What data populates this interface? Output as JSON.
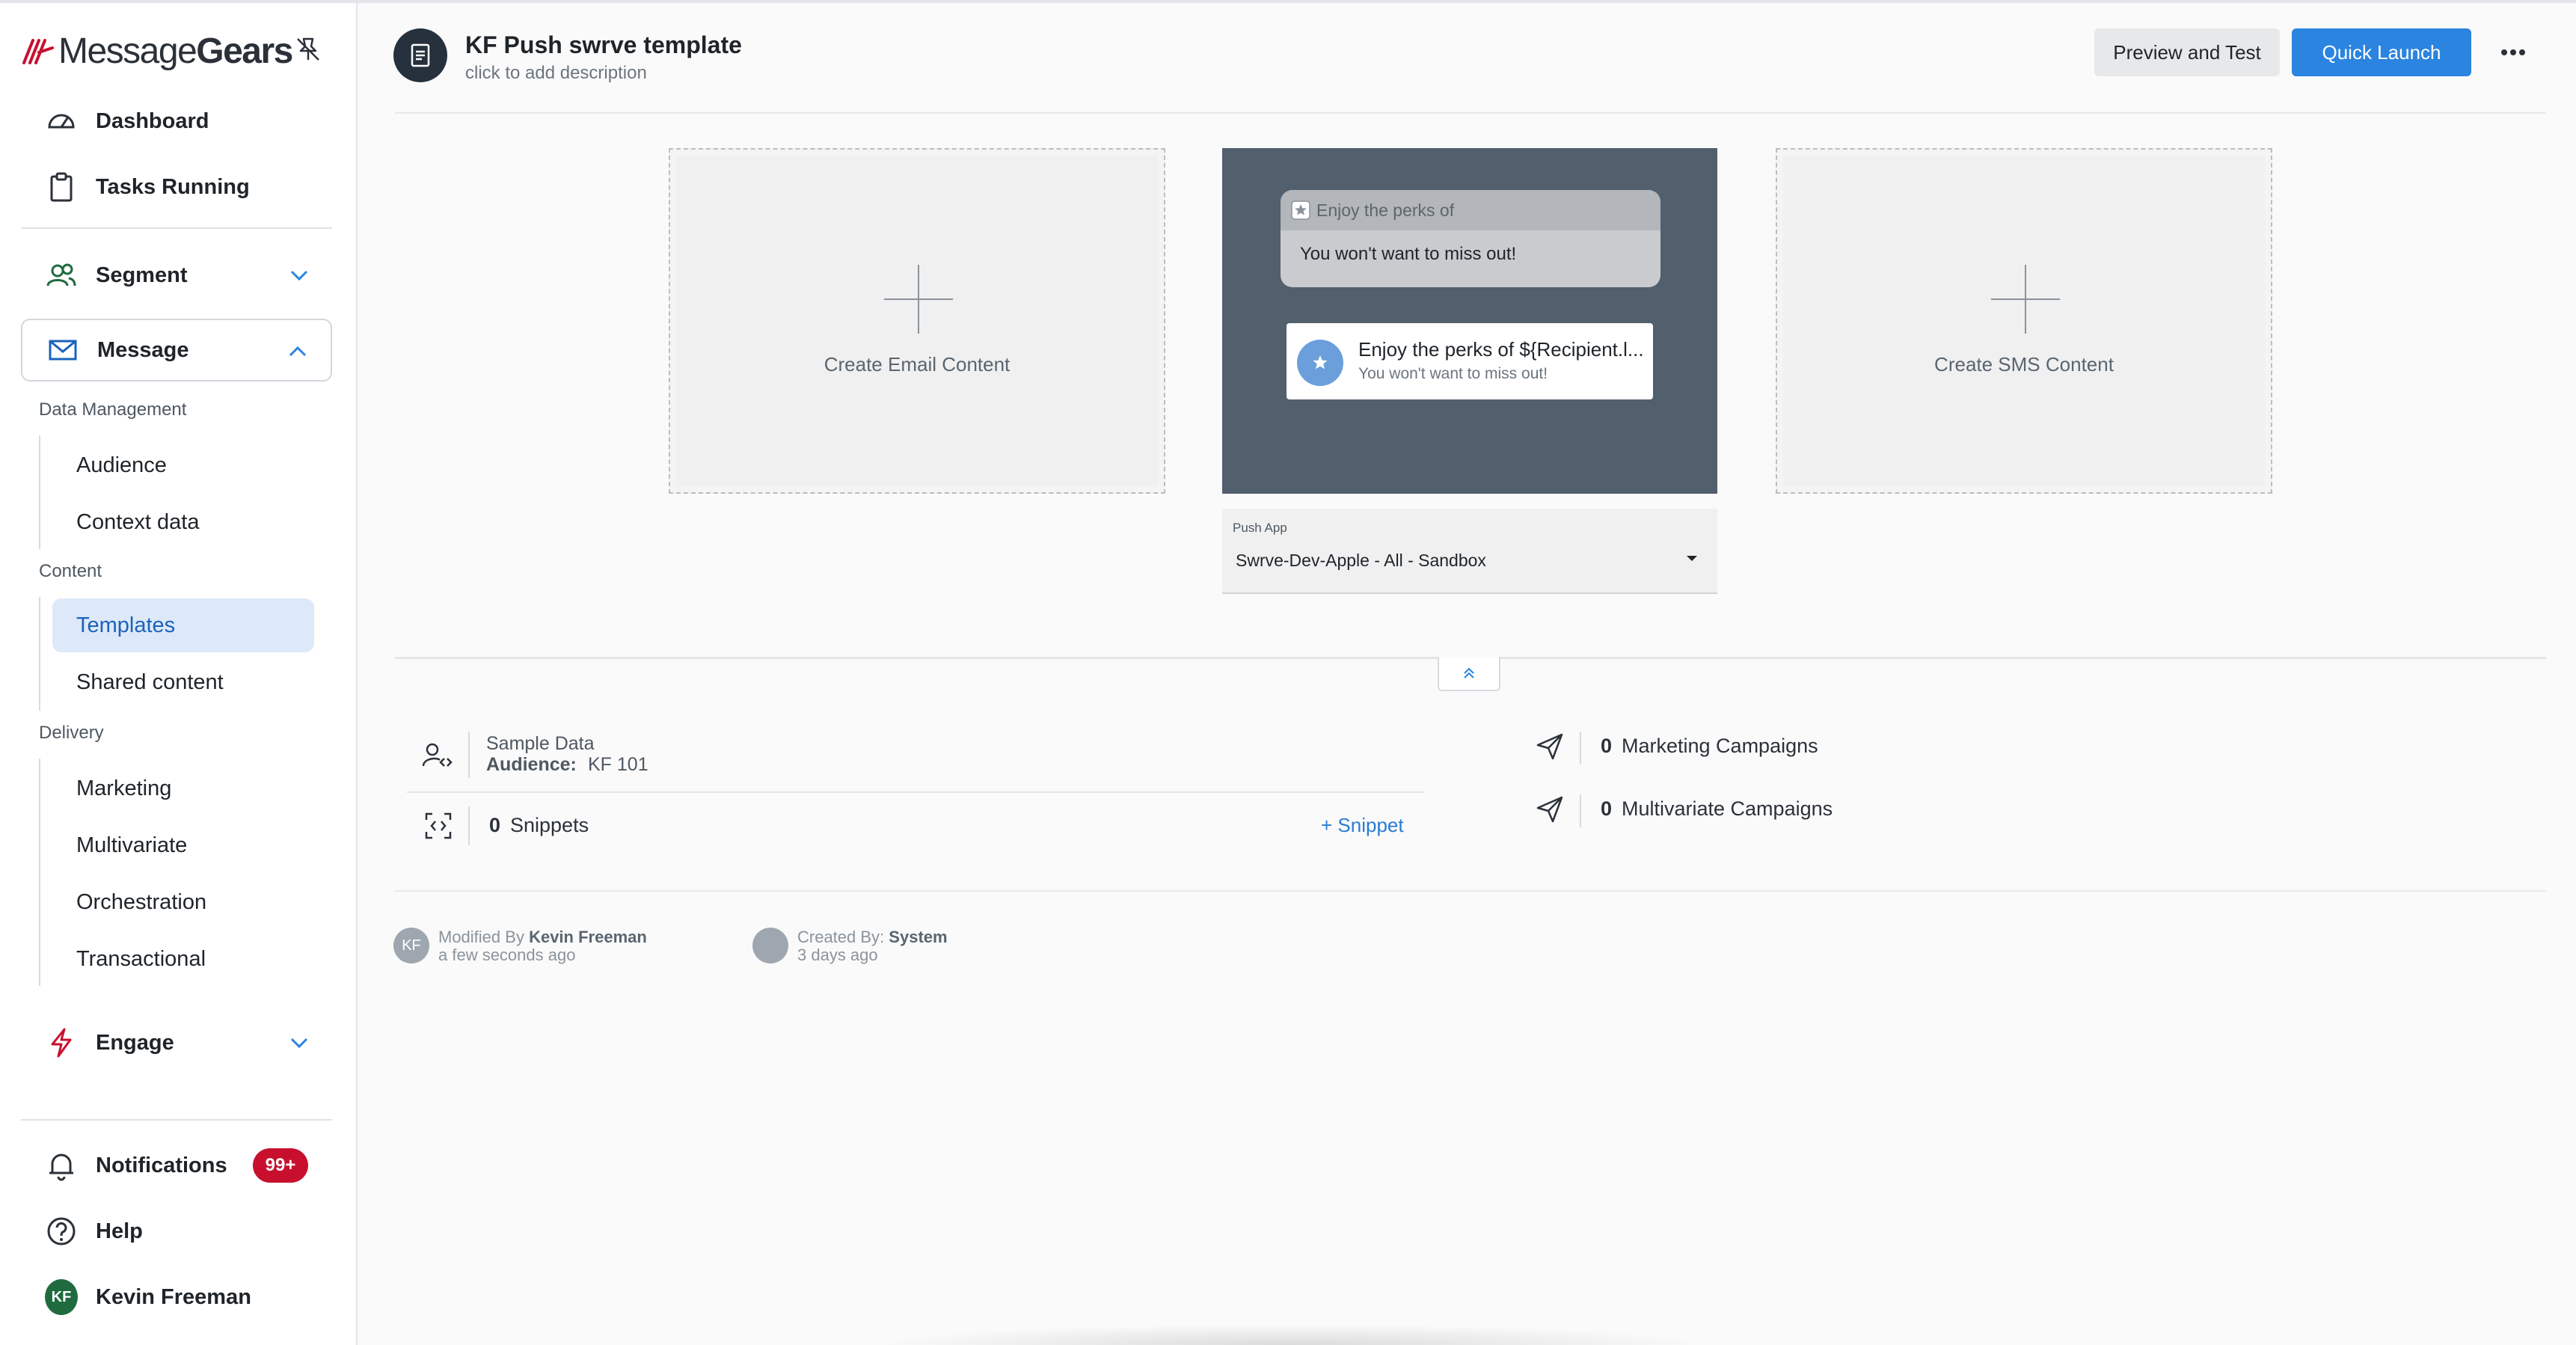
{
  "brand": {
    "name_light": "Message",
    "name_bold": "Gears"
  },
  "sidebar": {
    "dashboard": "Dashboard",
    "tasks_running": "Tasks Running",
    "segment": "Segment",
    "message": "Message",
    "sections": {
      "data_management": "Data Management",
      "content": "Content",
      "delivery": "Delivery"
    },
    "data_management_items": [
      "Audience",
      "Context data"
    ],
    "content_items": [
      "Templates",
      "Shared content"
    ],
    "delivery_items": [
      "Marketing",
      "Multivariate",
      "Orchestration",
      "Transactional"
    ],
    "engage": "Engage",
    "notifications": "Notifications",
    "notifications_badge": "99+",
    "help": "Help",
    "user_initials": "KF",
    "user_name": "Kevin Freeman"
  },
  "header": {
    "title": "KF Push swrve template",
    "description": "click to add description",
    "preview_button": "Preview and Test",
    "launch_button": "Quick Launch"
  },
  "cards": {
    "email_label": "Create Email Content",
    "sms_label": "Create SMS Content",
    "push": {
      "notif_a_title": "Enjoy the perks of",
      "notif_a_body": "You won't want to miss out!",
      "notif_b_title": "Enjoy the perks of ${Recipient.l...",
      "notif_b_body": "You won't want to miss out!"
    },
    "push_app_label": "Push App",
    "push_app_value": "Swrve-Dev-Apple - All - Sandbox"
  },
  "details": {
    "sample_data_label": "Sample Data",
    "audience_label": "Audience:",
    "audience_value": "KF 101",
    "snippets_count": "0",
    "snippets_label": "Snippets",
    "add_snippet": "+ Snippet",
    "marketing_count": "0",
    "marketing_label": "Marketing Campaigns",
    "multivariate_count": "0",
    "multivariate_label": "Multivariate Campaigns"
  },
  "meta": {
    "modified_prefix": "Modified By",
    "modified_by": "Kevin Freeman",
    "modified_when": "a few seconds ago",
    "modified_initials": "KF",
    "created_prefix": "Created By:",
    "created_by": "System",
    "created_when": "3 days ago"
  },
  "colors": {
    "accent": "#2a84e0",
    "brand_red": "#c8102e",
    "active_bg": "#dde9f8",
    "push_preview_bg": "#525f6d"
  }
}
